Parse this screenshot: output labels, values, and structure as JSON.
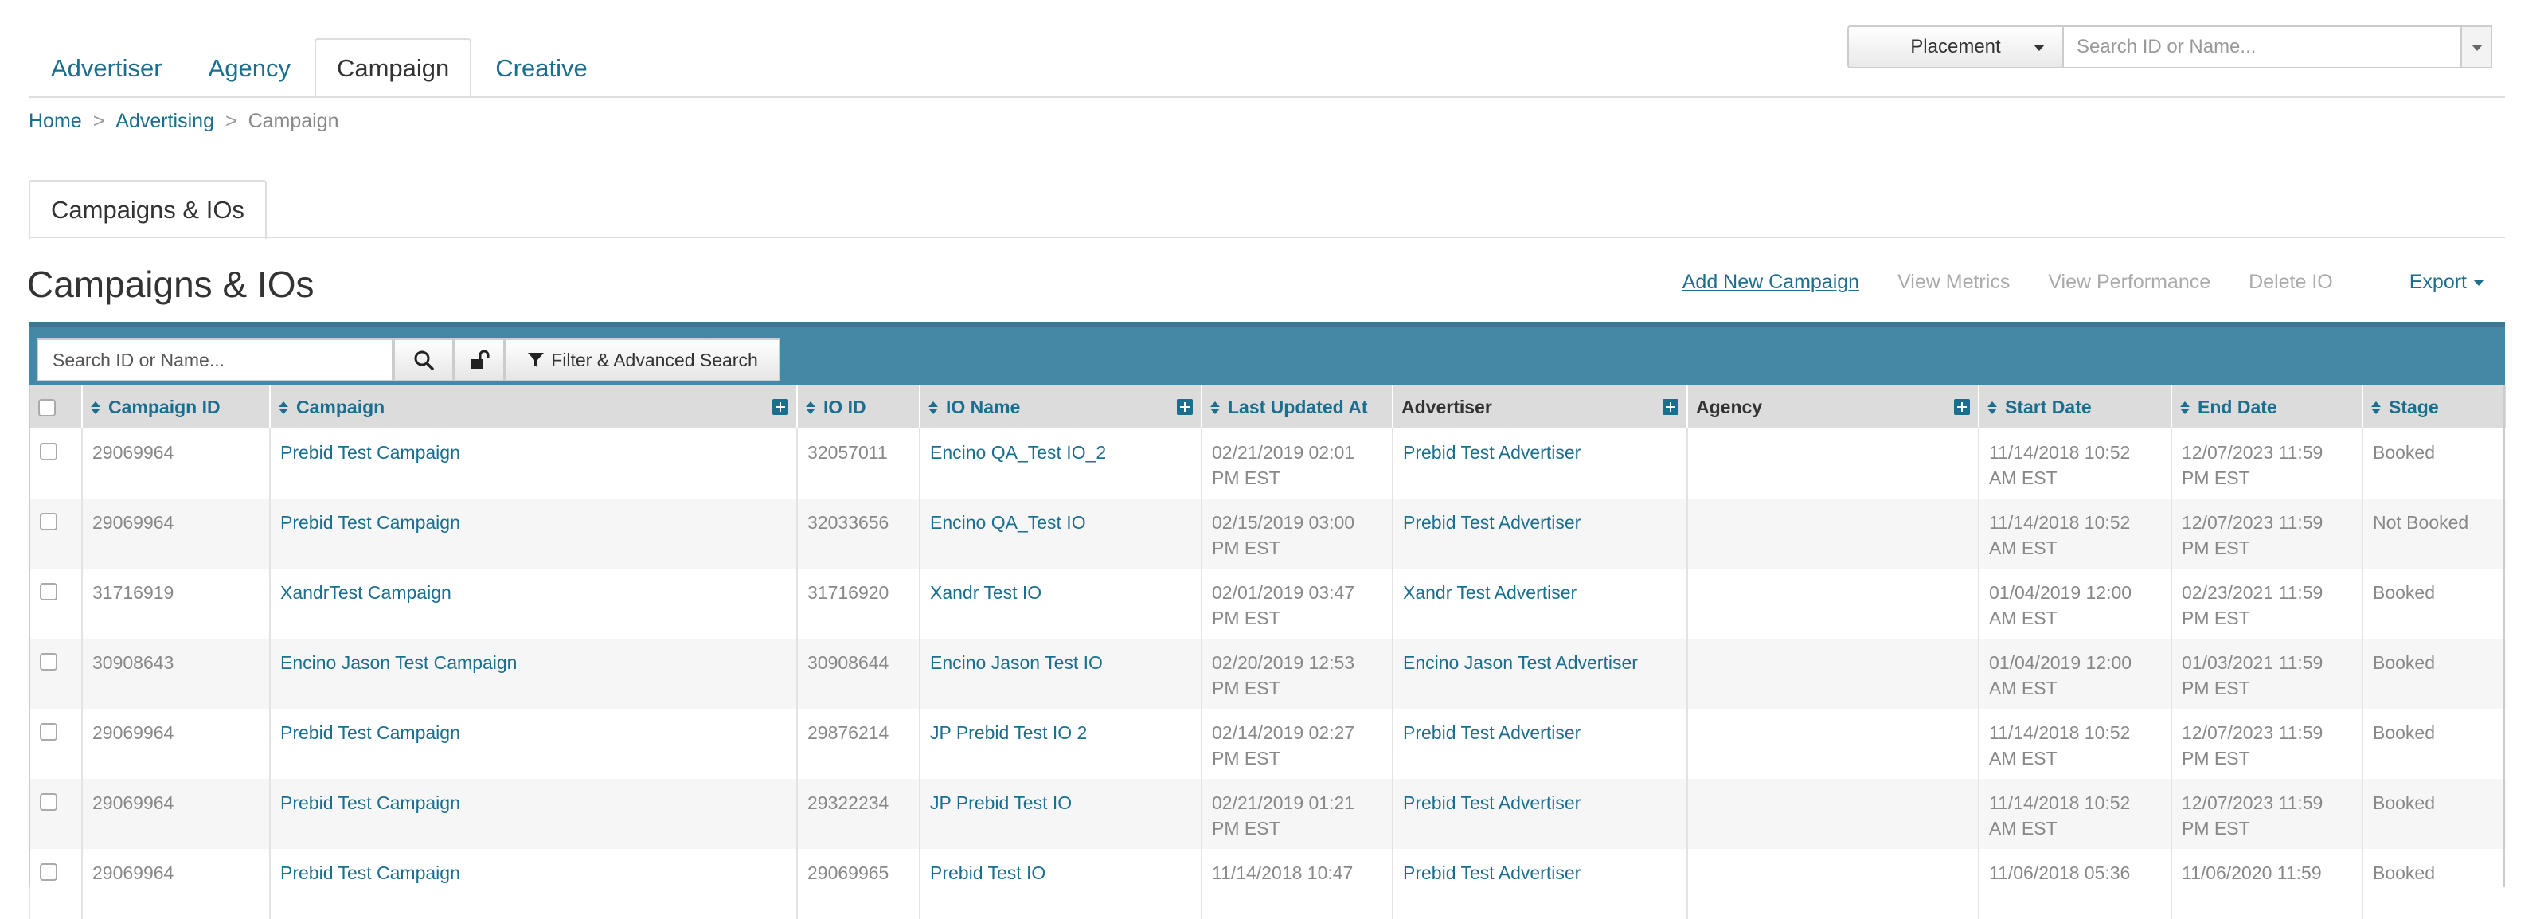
{
  "nav": {
    "tabs": [
      {
        "label": "Advertiser"
      },
      {
        "label": "Agency"
      },
      {
        "label": "Campaign"
      },
      {
        "label": "Creative"
      }
    ],
    "active_tab": "Campaign"
  },
  "top_search": {
    "selector_value": "Placement",
    "placeholder": "Search ID or Name..."
  },
  "breadcrumb": {
    "items": [
      "Home",
      "Advertising",
      "Campaign"
    ],
    "separator": ">"
  },
  "sub_tabs": {
    "active": "Campaigns & IOs"
  },
  "page_title": "Campaigns & IOs",
  "actions": {
    "add": "Add New Campaign",
    "view_metrics": "View Metrics",
    "view_performance": "View Performance",
    "delete": "Delete IO",
    "export": "Export"
  },
  "toolbar": {
    "search_placeholder": "Search ID or Name...",
    "filter_label": "Filter & Advanced Search"
  },
  "table": {
    "columns": [
      "Campaign ID",
      "Campaign",
      "IO ID",
      "IO Name",
      "Last Updated At",
      "Advertiser",
      "Agency",
      "Start Date",
      "End Date",
      "Stage"
    ],
    "rows": [
      {
        "campaign_id": "29069964",
        "campaign": "Prebid Test Campaign",
        "io_id": "32057011",
        "io_name": "Encino QA_Test IO_2",
        "updated_1": "02/21/2019 02:01",
        "updated_2": "PM EST",
        "advertiser": "Prebid Test Advertiser",
        "agency": "",
        "start_1": "11/14/2018 10:52",
        "start_2": "AM EST",
        "end_1": "12/07/2023 11:59",
        "end_2": "PM EST",
        "stage": "Booked"
      },
      {
        "campaign_id": "29069964",
        "campaign": "Prebid Test Campaign",
        "io_id": "32033656",
        "io_name": "Encino QA_Test IO",
        "updated_1": "02/15/2019 03:00",
        "updated_2": "PM EST",
        "advertiser": "Prebid Test Advertiser",
        "agency": "",
        "start_1": "11/14/2018 10:52",
        "start_2": "AM EST",
        "end_1": "12/07/2023 11:59",
        "end_2": "PM EST",
        "stage": "Not Booked"
      },
      {
        "campaign_id": "31716919",
        "campaign": "XandrTest Campaign",
        "io_id": "31716920",
        "io_name": "Xandr Test IO",
        "updated_1": "02/01/2019 03:47",
        "updated_2": "PM EST",
        "advertiser": "Xandr Test Advertiser",
        "agency": "",
        "start_1": "01/04/2019 12:00",
        "start_2": "AM EST",
        "end_1": "02/23/2021 11:59",
        "end_2": "PM EST",
        "stage": "Booked"
      },
      {
        "campaign_id": "30908643",
        "campaign": "Encino Jason Test Campaign",
        "io_id": "30908644",
        "io_name": "Encino Jason Test IO",
        "updated_1": "02/20/2019 12:53",
        "updated_2": "PM EST",
        "advertiser": "Encino Jason Test Advertiser",
        "agency": "",
        "start_1": "01/04/2019 12:00",
        "start_2": "AM EST",
        "end_1": "01/03/2021 11:59",
        "end_2": "PM EST",
        "stage": "Booked"
      },
      {
        "campaign_id": "29069964",
        "campaign": "Prebid Test Campaign",
        "io_id": "29876214",
        "io_name": "JP Prebid Test IO 2",
        "updated_1": "02/14/2019 02:27",
        "updated_2": "PM EST",
        "advertiser": "Prebid Test Advertiser",
        "agency": "",
        "start_1": "11/14/2018 10:52",
        "start_2": "AM EST",
        "end_1": "12/07/2023 11:59",
        "end_2": "PM EST",
        "stage": "Booked"
      },
      {
        "campaign_id": "29069964",
        "campaign": "Prebid Test Campaign",
        "io_id": "29322234",
        "io_name": "JP Prebid Test IO",
        "updated_1": "02/21/2019 01:21",
        "updated_2": "PM EST",
        "advertiser": "Prebid Test Advertiser",
        "agency": "",
        "start_1": "11/14/2018 10:52",
        "start_2": "AM EST",
        "end_1": "12/07/2023 11:59",
        "end_2": "PM EST",
        "stage": "Booked"
      },
      {
        "campaign_id": "29069964",
        "campaign": "Prebid Test Campaign",
        "io_id": "29069965",
        "io_name": "Prebid Test IO",
        "updated_1": "11/14/2018 10:47",
        "updated_2": "",
        "advertiser": "Prebid Test Advertiser",
        "agency": "",
        "start_1": "11/06/2018 05:36",
        "start_2": "",
        "end_1": "11/06/2020 11:59",
        "end_2": "",
        "stage": "Booked"
      }
    ]
  }
}
